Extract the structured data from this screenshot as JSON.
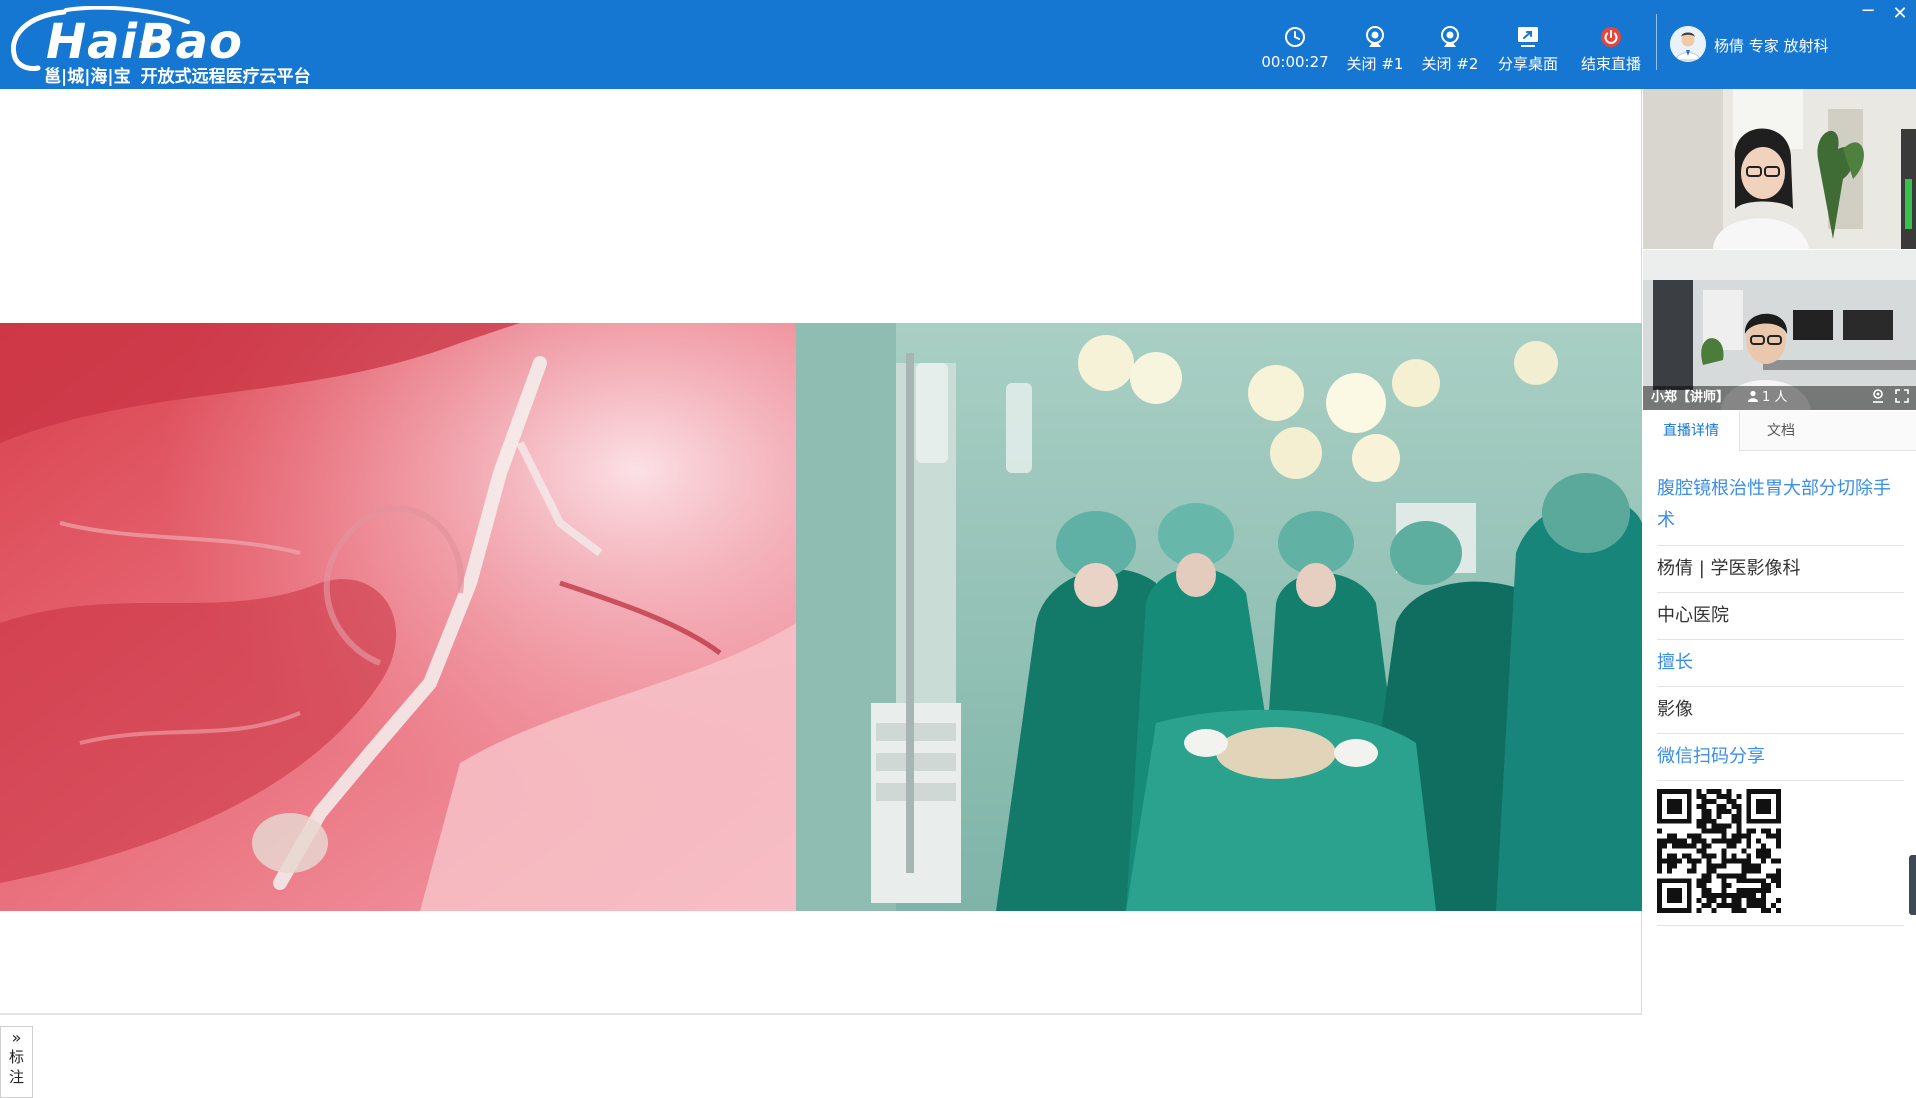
{
  "app": {
    "logo_text": "HaiBao",
    "logo_sub": "邕|城|海|宝",
    "tagline": "开放式远程医疗云平台"
  },
  "toolbar": {
    "timer": "00:00:27",
    "close_cam1": "关闭 #1",
    "close_cam2": "关闭 #2",
    "share_desktop": "分享桌面",
    "end_live": "结束直播"
  },
  "user": {
    "display": "杨倩 专家 放射科"
  },
  "window": {
    "minimize": "−",
    "close": "✕"
  },
  "annotation": {
    "chevron": "»",
    "label_1": "标",
    "label_2": "注"
  },
  "video2": {
    "name": "小郑【讲师】",
    "count": "1 人"
  },
  "tabs": {
    "details": "直播详情",
    "docs": "文档"
  },
  "details": {
    "title": "腹腔镜根治性胃大部分切除手术",
    "doctor": "杨倩 | 学医影像科",
    "hospital": "中心医院",
    "specialty_label": "擅长",
    "specialty_value": "影像",
    "share_label": "微信扫码分享"
  },
  "colors": {
    "brand": "#1677d2",
    "link": "#3a8ee6",
    "end_live_icon": "#e8443a"
  },
  "icons": {
    "timer": "clock-icon",
    "cam1": "webcam-icon",
    "cam2": "webcam-icon",
    "share": "share-screen-icon",
    "end": "power-icon",
    "location": "location-icon",
    "fullscreen": "fullscreen-icon",
    "person": "person-icon"
  }
}
